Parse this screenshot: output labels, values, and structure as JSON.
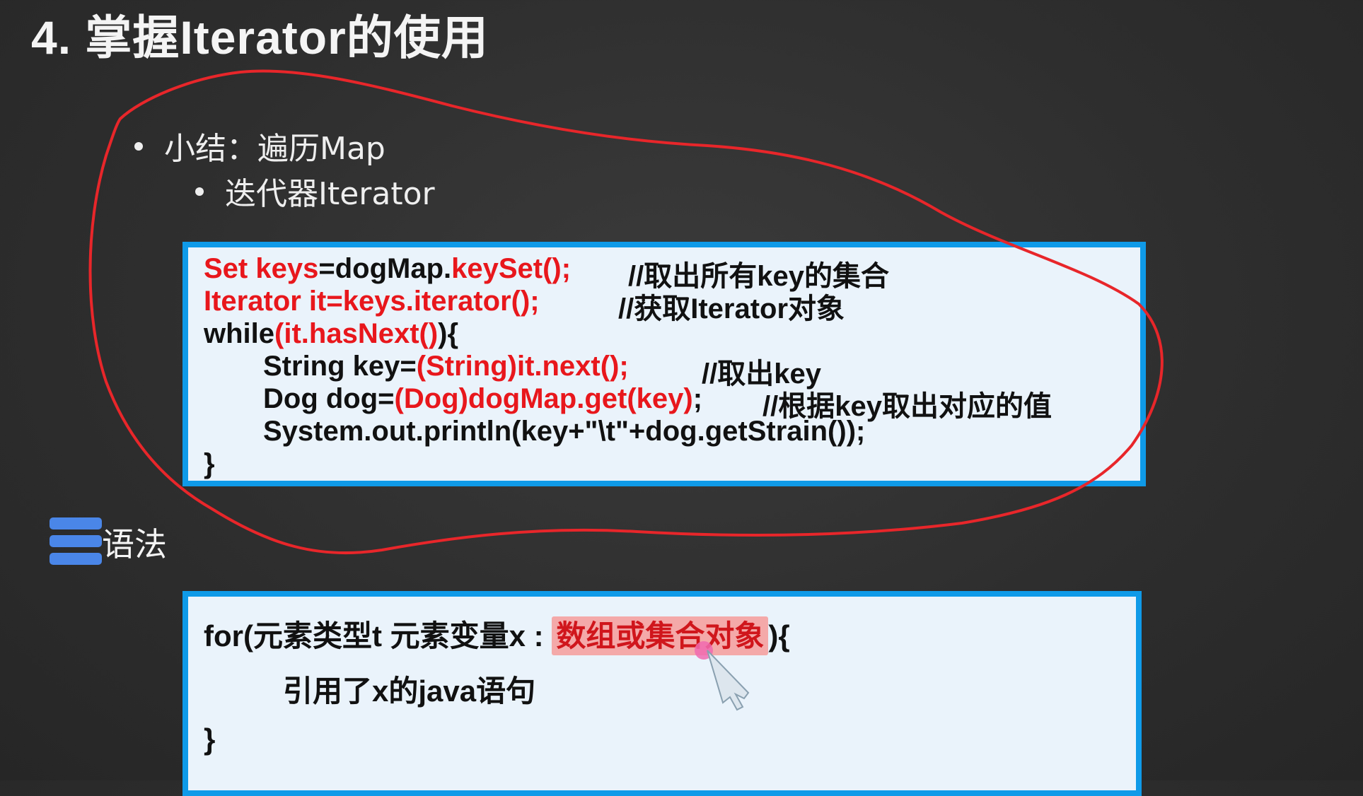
{
  "title": "4. 掌握Iterator的使用",
  "summary": {
    "bullet1": "小结：遍历Map",
    "bullet2": "迭代器Iterator"
  },
  "code": {
    "line1_a": "Set keys",
    "line1_b": "=dogMap.",
    "line1_c": "keySet();",
    "line1_comment": "//取出所有key的集合",
    "line2_a": "Iterator it=keys.iterator();",
    "line2_comment": "//获取Iterator对象",
    "line3_a": "while",
    "line3_b": "(it.hasNext()",
    "line3_c": "){",
    "line4_a": "String key=",
    "line4_b": "(String)it.next();",
    "line4_comment": "//取出key",
    "line5_a": "Dog dog=",
    "line5_b": "(Dog)dogMap.get(key)",
    "line5_c": ";",
    "line5_comment": "//根据key取出对应的值",
    "line6": "System.out.println(key+\"\\t\"+dog.getStrain());",
    "line7": "}"
  },
  "syntax": {
    "label": "语法",
    "icon": "list-icon"
  },
  "for_syntax": {
    "line1_a": "for(元素类型t  元素变量x : ",
    "line1_highlight": "数组或集合对象",
    "line1_c": "){",
    "line2": "引用了x的java语句",
    "line3": "}"
  },
  "colors": {
    "accent_red": "#e8171c",
    "box_border": "#0f9ae8",
    "box_bg": "#eaf3fb",
    "annotation": "#e8262a",
    "highlight": "#f4a9a9"
  }
}
